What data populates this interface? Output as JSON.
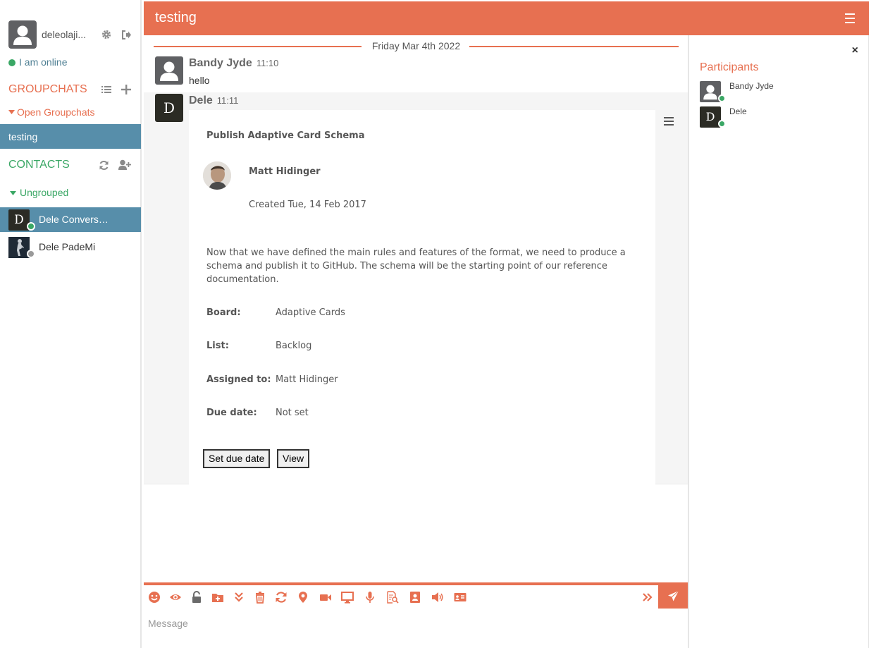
{
  "user": {
    "name": "deleolaji...",
    "status": "I am online"
  },
  "sidebar": {
    "groupchats_title": "GROUPCHATS",
    "open_groupchats": "Open Groupchats",
    "rooms": [
      {
        "label": "testing"
      }
    ],
    "contacts_title": "CONTACTS",
    "group_label": "Ungrouped",
    "contacts": [
      {
        "name": "Dele Convers…",
        "initial": "D",
        "status": "online"
      },
      {
        "name": "Dele PadeMi",
        "initial": "",
        "status": "offline"
      }
    ]
  },
  "chat": {
    "title": "testing",
    "date_separator": "Friday Mar 4th 2022",
    "messages": [
      {
        "sender": "Bandy Jyde",
        "time": "11:10",
        "text": "hello"
      },
      {
        "sender": "Dele",
        "initial": "D",
        "time": "11:11"
      }
    ],
    "card": {
      "title": "Publish Adaptive Card Schema",
      "author": "Matt Hidinger",
      "created": "Created Tue, 14 Feb 2017",
      "body": "Now that we have defined the main rules and features of the format, we need to produce a schema and publish it to GitHub. The schema will be the starting point of our reference documentation.",
      "facts": [
        {
          "key": "Board:",
          "value": "Adaptive Cards"
        },
        {
          "key": "List:",
          "value": "Backlog"
        },
        {
          "key": "Assigned to:",
          "value": "Matt Hidinger"
        },
        {
          "key": "Due date:",
          "value": "Not set"
        }
      ],
      "actions": [
        "Set due date",
        "View"
      ]
    },
    "composer": {
      "placeholder": "Message"
    }
  },
  "participants": {
    "title": "Participants",
    "close_label": "×",
    "list": [
      {
        "name": "Bandy Jyde",
        "initial": ""
      },
      {
        "name": "Dele",
        "initial": "D"
      }
    ]
  },
  "colors": {
    "accent": "#e77051",
    "selected": "#578eaa",
    "online": "#3aa765",
    "contacts": "#3aa765"
  },
  "icons": {
    "toolbar": [
      "emoji-icon",
      "eye-icon",
      "unlock-icon",
      "folder-upload-icon",
      "double-chevron-down-icon",
      "trash-icon",
      "refresh-icon",
      "location-pin-icon",
      "video-camera-icon",
      "desktop-icon",
      "microphone-icon",
      "document-search-icon",
      "contact-book-icon",
      "volume-icon",
      "id-card-icon",
      "double-chevron-right-icon",
      "send-icon"
    ]
  }
}
